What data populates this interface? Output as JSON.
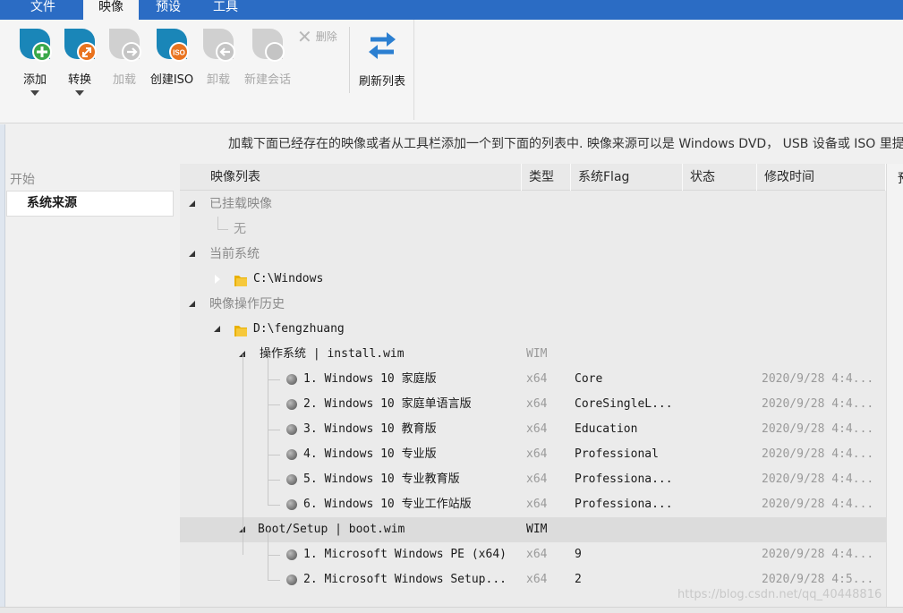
{
  "menu": {
    "tabs": [
      {
        "label": "文件",
        "active": false
      },
      {
        "label": "映像",
        "active": true
      },
      {
        "label": "预设",
        "active": false
      },
      {
        "label": "工具",
        "active": false
      }
    ]
  },
  "ribbon": {
    "add": "添加",
    "convert": "转换",
    "mount": "加载",
    "create_iso": "创建ISO",
    "unmount": "卸载",
    "new_session": "新建会话",
    "delete": "删除",
    "refresh": "刷新列表"
  },
  "left": {
    "start": "开始",
    "source": "系统来源"
  },
  "hint": "加载下面已经存在的映像或者从工具栏添加一个到下面的列表中. 映像来源可以是 Windows DVD， USB 设备或 ISO 里提取",
  "table": {
    "columns": {
      "name": "映像列表",
      "type": "类型",
      "flag": "系统Flag",
      "status": "状态",
      "modified": "修改时间",
      "extra": "预"
    },
    "groups": {
      "mounted": "已挂载映像",
      "none": "无",
      "current": "当前系统",
      "current_path": "C:\\Windows",
      "history": "映像操作历史",
      "history_path": "D:\\fengzhuang"
    },
    "wim1": {
      "name": "操作系统  |  install.wim",
      "type": "WIM"
    },
    "wim1_items": [
      {
        "name": "1. Windows 10 家庭版",
        "type": "x64",
        "flag": "Core",
        "modified": "2020/9/28 4:4..."
      },
      {
        "name": "2. Windows 10 家庭单语言版",
        "type": "x64",
        "flag": "CoreSingleL...",
        "modified": "2020/9/28 4:4..."
      },
      {
        "name": "3. Windows 10 教育版",
        "type": "x64",
        "flag": "Education",
        "modified": "2020/9/28 4:4..."
      },
      {
        "name": "4. Windows 10 专业版",
        "type": "x64",
        "flag": "Professional",
        "modified": "2020/9/28 4:4..."
      },
      {
        "name": "5. Windows 10 专业教育版",
        "type": "x64",
        "flag": "Professiona...",
        "modified": "2020/9/28 4:4..."
      },
      {
        "name": "6. Windows 10 专业工作站版",
        "type": "x64",
        "flag": "Professiona...",
        "modified": "2020/9/28 4:4..."
      }
    ],
    "wim2": {
      "name": "Boot/Setup  |  boot.wim",
      "type": "WIM"
    },
    "wim2_items": [
      {
        "name": "1. Microsoft Windows PE (x64)",
        "type": "x64",
        "flag": "9",
        "modified": "2020/9/28 4:4..."
      },
      {
        "name": "2. Microsoft Windows Setup...",
        "type": "x64",
        "flag": "2",
        "modified": "2020/9/28 4:5..."
      }
    ]
  },
  "watermark": "https://blog.csdn.net/qq_40448816",
  "colors": {
    "accent": "#2b6cc4",
    "brand_teal": "#1a86b8",
    "add_green": "#3aa84a",
    "convert_orange": "#e9731f"
  },
  "icons": {
    "add": "disc-add-icon",
    "convert": "disc-convert-icon",
    "mount": "disc-mount-icon",
    "iso": "disc-iso-icon",
    "unmount": "disc-unmount-icon",
    "session": "disc-session-icon",
    "delete": "close-icon",
    "refresh": "refresh-icon",
    "folder": "folder-icon",
    "image": "disk-image-icon"
  }
}
